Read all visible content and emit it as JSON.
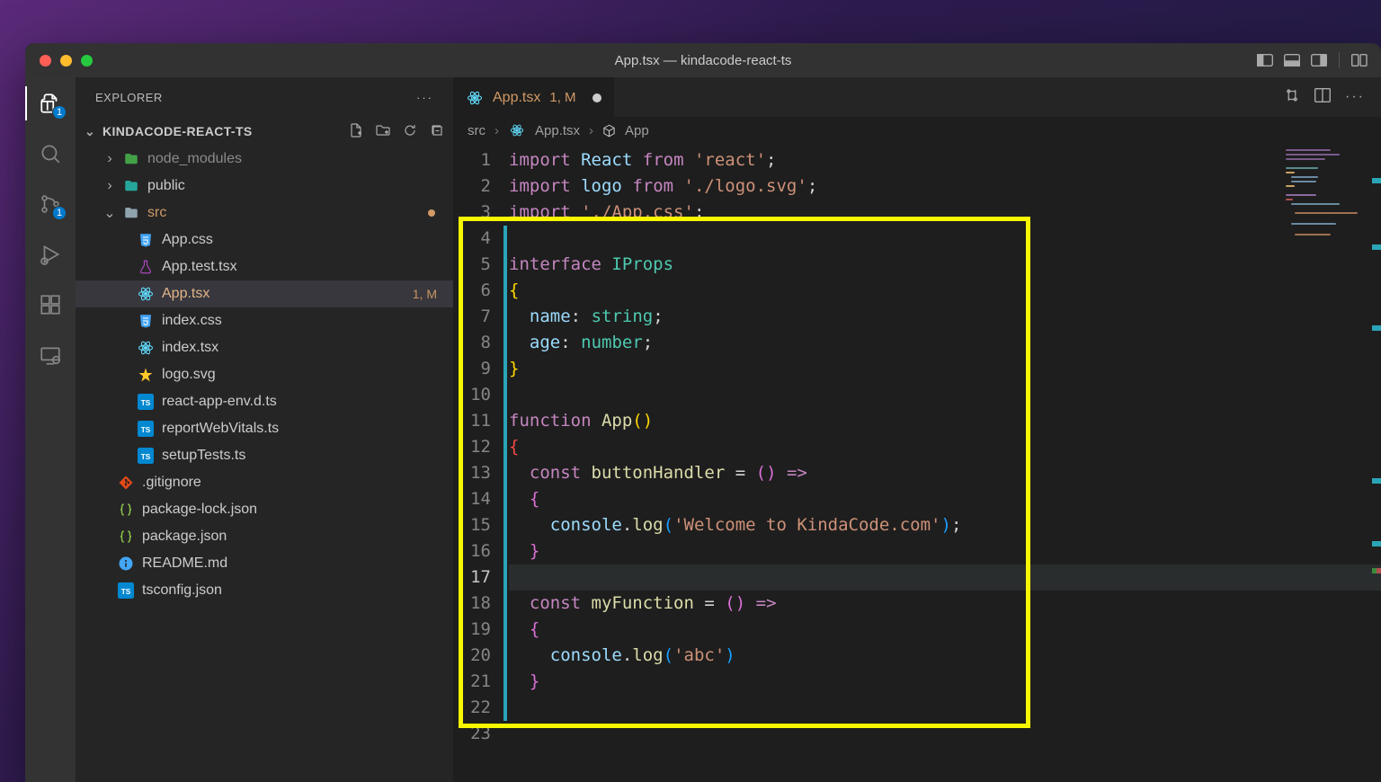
{
  "window": {
    "title": "App.tsx — kindacode-react-ts"
  },
  "activity": {
    "explorer_badge": "1",
    "scm_badge": "1"
  },
  "sidebar": {
    "title": "EXPLORER",
    "root": "KINDACODE-REACT-TS",
    "items": [
      {
        "depth": 1,
        "kind": "folder",
        "icon": "folder-green",
        "caret": "right",
        "label": "node_modules",
        "dim": true
      },
      {
        "depth": 1,
        "kind": "folder",
        "icon": "folder-teal",
        "caret": "right",
        "label": "public"
      },
      {
        "depth": 1,
        "kind": "folder",
        "icon": "folder-generic",
        "caret": "down",
        "label": "src",
        "tint": "#d19a66",
        "modDot": true
      },
      {
        "depth": 2,
        "kind": "file",
        "icon": "css",
        "label": "App.css"
      },
      {
        "depth": 2,
        "kind": "file",
        "icon": "flask",
        "label": "App.test.tsx"
      },
      {
        "depth": 2,
        "kind": "file",
        "icon": "react",
        "label": "App.tsx",
        "active": true,
        "status": "1, M"
      },
      {
        "depth": 2,
        "kind": "file",
        "icon": "css",
        "label": "index.css"
      },
      {
        "depth": 2,
        "kind": "file",
        "icon": "react",
        "label": "index.tsx"
      },
      {
        "depth": 2,
        "kind": "file",
        "icon": "svg",
        "label": "logo.svg"
      },
      {
        "depth": 2,
        "kind": "file",
        "icon": "ts",
        "label": "react-app-env.d.ts"
      },
      {
        "depth": 2,
        "kind": "file",
        "icon": "ts",
        "label": "reportWebVitals.ts"
      },
      {
        "depth": 2,
        "kind": "file",
        "icon": "ts",
        "label": "setupTests.ts"
      },
      {
        "depth": 1,
        "kind": "file",
        "icon": "git",
        "label": ".gitignore"
      },
      {
        "depth": 1,
        "kind": "file",
        "icon": "json",
        "label": "package-lock.json"
      },
      {
        "depth": 1,
        "kind": "file",
        "icon": "json",
        "label": "package.json"
      },
      {
        "depth": 1,
        "kind": "file",
        "icon": "info",
        "label": "README.md"
      },
      {
        "depth": 1,
        "kind": "file",
        "icon": "ts",
        "label": "tsconfig.json"
      }
    ]
  },
  "tab": {
    "icon": "react",
    "label": "App.tsx",
    "status": "1, M",
    "modified": true
  },
  "breadcrumbs": {
    "seg1": "src",
    "seg2": "App.tsx",
    "seg3": "App"
  },
  "code": {
    "lines": [
      {
        "n": 1,
        "html": "<span class='kw'>import</span> <span class='id'>React</span> <span class='kw'>from</span> <span class='str'>'react'</span><span class='pn'>;</span>"
      },
      {
        "n": 2,
        "html": "<span class='kw'>import</span> <span class='id'>logo</span> <span class='kw'>from</span> <span class='str'>'./logo.svg'</span><span class='pn'>;</span>"
      },
      {
        "n": 3,
        "html": "<span class='kw'>import</span> <span class='str'>'./App.css'</span><span class='pn'>;</span>"
      },
      {
        "n": 4,
        "html": "",
        "mark": true
      },
      {
        "n": 5,
        "html": "<span class='kw'>interface</span> <span class='tp'>IProps</span>",
        "mark": true
      },
      {
        "n": 6,
        "html": "<span class='br'>{</span>",
        "mark": true
      },
      {
        "n": 7,
        "html": "  <span class='id'>name</span><span class='pn'>:</span> <span class='tp'>string</span><span class='pn'>;</span>",
        "mark": true
      },
      {
        "n": 8,
        "html": "  <span class='id'>age</span><span class='pn'>:</span> <span class='tp'>number</span><span class='pn'>;</span>",
        "mark": true
      },
      {
        "n": 9,
        "html": "<span class='br'>}</span>",
        "mark": true
      },
      {
        "n": 10,
        "html": "",
        "mark": true
      },
      {
        "n": 11,
        "html": "<span class='kw'>function</span> <span class='fn'>App</span><span class='br'>(</span><span class='br'>)</span>",
        "mark": true
      },
      {
        "n": 12,
        "html": "<span class='br' style='color:#f44747'>{</span>",
        "mark": true
      },
      {
        "n": 13,
        "html": "  <span class='kw'>const</span> <span class='fn'>buttonHandler</span> <span class='op'>=</span> <span class='br2'>(</span><span class='br2'>)</span> <span class='kw'>=&gt;</span>",
        "mark": true
      },
      {
        "n": 14,
        "html": "  <span class='br2'>{</span>",
        "mark": true
      },
      {
        "n": 15,
        "html": "    <span class='id'>console</span><span class='pn'>.</span><span class='fn'>log</span><span class='br3'>(</span><span class='str'>'Welcome to KindaCode.com'</span><span class='br3'>)</span><span class='pn'>;</span>",
        "mark": true
      },
      {
        "n": 16,
        "html": "  <span class='br2'>}</span>",
        "mark": true
      },
      {
        "n": 17,
        "html": "",
        "mark": true,
        "current": true
      },
      {
        "n": 18,
        "html": "  <span class='kw'>const</span> <span class='fn'>myFunction</span> <span class='op'>=</span> <span class='br2'>(</span><span class='br2'>)</span> <span class='kw'>=&gt;</span>",
        "mark": true
      },
      {
        "n": 19,
        "html": "  <span class='br2'>{</span>",
        "mark": true
      },
      {
        "n": 20,
        "html": "    <span class='id'>console</span><span class='pn'>.</span><span class='fn'>log</span><span class='br3'>(</span><span class='str'>'abc'</span><span class='br3'>)</span>",
        "mark": true
      },
      {
        "n": 21,
        "html": "  <span class='br2'>}</span>",
        "mark": true
      },
      {
        "n": 22,
        "html": "",
        "mark": true
      },
      {
        "n": 23,
        "html": ""
      }
    ],
    "highlight": {
      "fromLine": 4,
      "toLine": 22
    }
  }
}
